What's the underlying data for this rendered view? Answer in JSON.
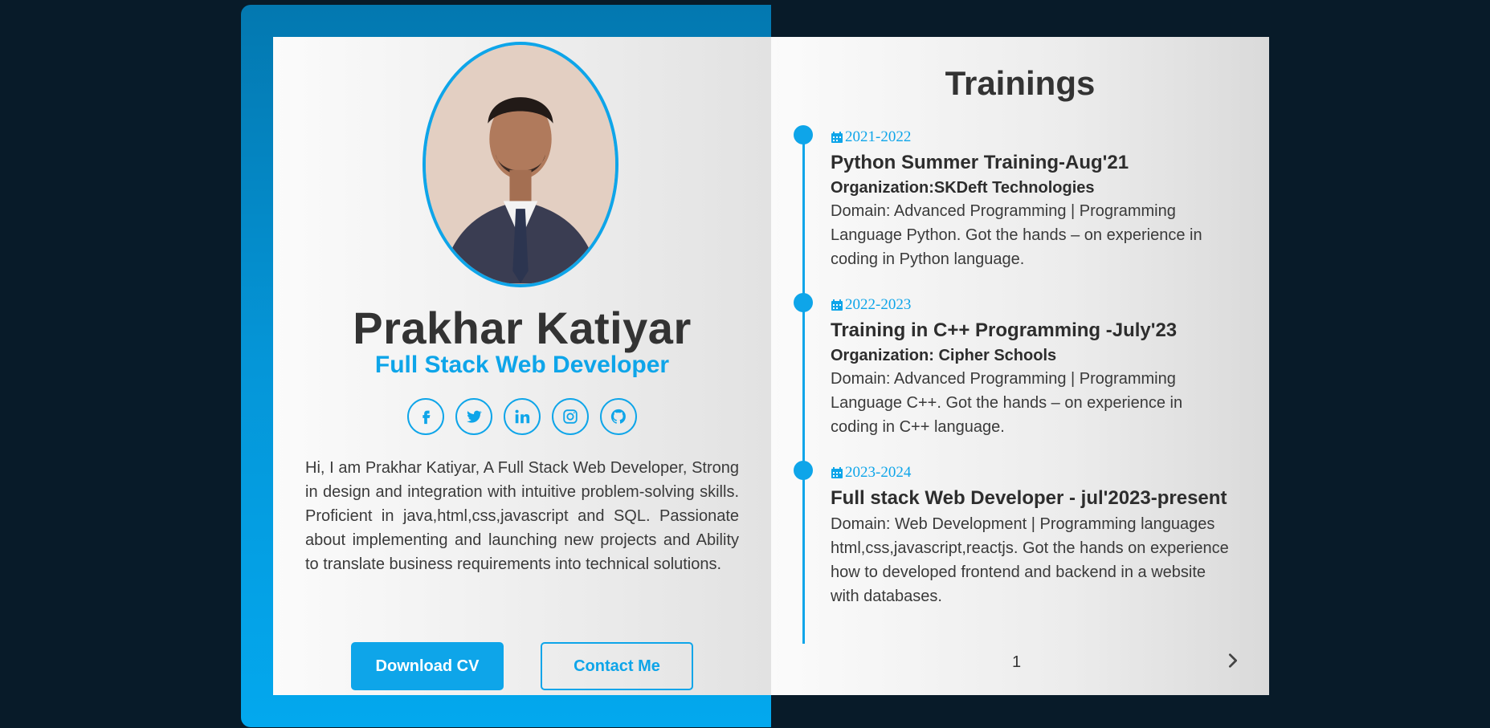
{
  "profile": {
    "name": "Prakhar Katiyar",
    "role": "Full Stack Web Developer",
    "bio": "Hi, I am Prakhar Katiyar, A Full Stack Web Developer, Strong in design and integration with intuitive problem-solving skills. Proficient in java,html,css,javascript and SQL. Passionate about implementing and launching new projects and Ability to translate business requirements into technical solutions.",
    "socials": [
      "facebook-icon",
      "twitter-icon",
      "linkedin-icon",
      "instagram-icon",
      "github-icon"
    ],
    "buttons": {
      "download": "Download CV",
      "contact": "Contact Me"
    }
  },
  "trainings": {
    "heading": "Trainings",
    "items": [
      {
        "date": "2021-2022",
        "title": "Python Summer Training-Aug'21",
        "organization": "Organization:SKDeft Technologies",
        "description": "Domain: Advanced Programming | Programming Language Python. Got the hands – on experience in coding in Python language."
      },
      {
        "date": "2022-2023",
        "title": "Training in C++ Programming -July'23",
        "organization": "Organization: Cipher Schools",
        "description": "Domain: Advanced Programming | Programming Language C++. Got the hands – on experience in coding in C++ language."
      },
      {
        "date": "2023-2024",
        "title": "Full stack Web Developer - jul'2023-present",
        "organization": "",
        "description": "Domain: Web Development | Programming languages html,css,javascript,reactjs. Got the hands on experience how to developed frontend and backend in a website with databases."
      }
    ],
    "page_number": "1"
  },
  "colors": {
    "accent": "#0ea5e9",
    "background": "#081b29",
    "text": "#333333"
  }
}
